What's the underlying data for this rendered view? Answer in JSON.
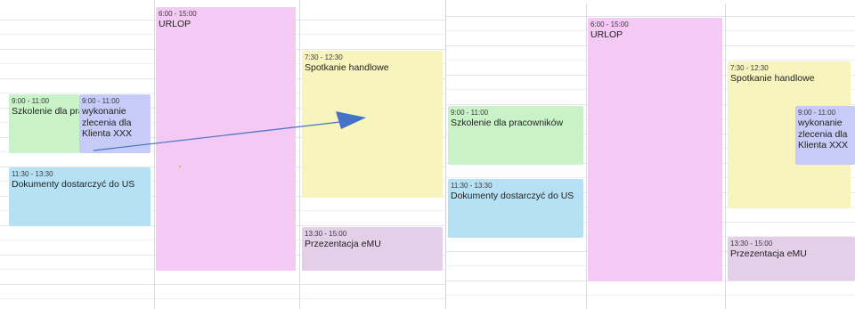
{
  "left_view": {
    "events": {
      "urlop": {
        "time": "6:00 - 15:00",
        "title": "URLOP"
      },
      "spotkanie": {
        "time": "7:30 - 12:30",
        "title": "Spotkanie handlowe"
      },
      "szkolenie": {
        "time": "9:00 - 11:00",
        "title": "Szkolenie dla prac"
      },
      "wykonanie": {
        "time": "9:00 - 11:00",
        "title": "wykonanie zlecenia dla Klienta XXX"
      },
      "dokumenty": {
        "time": "11:30 - 13:30",
        "title": "Dokumenty dostarczyć do US"
      },
      "prezentacja": {
        "time": "13:30 - 15:00",
        "title": "Przezentacja eMU"
      }
    }
  },
  "right_view": {
    "events": {
      "urlop": {
        "time": "6:00 - 15:00",
        "title": "URLOP"
      },
      "spotkanie": {
        "time": "7:30 - 12:30",
        "title": "Spotkanie handlowe"
      },
      "szkolenie": {
        "time": "9:00 - 11:00",
        "title": "Szkolenie dla pracowników"
      },
      "wykonanie": {
        "time": "9:00 - 11:00",
        "title": "wykonanie zlecenia dla Klienta XXX"
      },
      "dokumenty": {
        "time": "11:30 - 13:30",
        "title": "Dokumenty dostarczyć do US"
      },
      "prezentacja": {
        "time": "13:30 - 15:00",
        "title": "Przezentacja eMU"
      }
    }
  },
  "colors": {
    "urlop": "#f4c9f3",
    "spotkanie": "#f8f4bd",
    "szkolenie": "#c9f2c9",
    "wykonanie": "#c6cbf7",
    "dokumenty": "#b6e1f4",
    "prezentacja": "#e3cfe8",
    "arrow": "#4472c4"
  },
  "annotation": {
    "icon": "arrow-right-icon"
  }
}
